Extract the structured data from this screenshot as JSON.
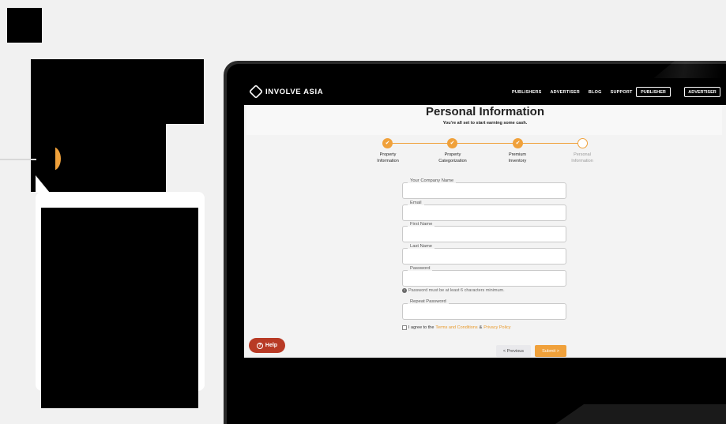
{
  "colors": {
    "accent": "#f0a13b",
    "help_red": "#b83a25",
    "navbar": "#000000"
  },
  "navbar": {
    "logo_text": "INVOLVE ASIA",
    "links": [
      "PUBLISHERS",
      "ADVERTISER",
      "BLOG",
      "SUPPORT"
    ],
    "publisher_button": "PUBLISHER",
    "advertiser_button": "ADVERTISER"
  },
  "page": {
    "title": "Personal Information",
    "subtitle": "You're all set to start earning some cash."
  },
  "stepper": {
    "steps": [
      {
        "label_line1": "Property",
        "label_line2": "Information",
        "state": "completed"
      },
      {
        "label_line1": "Property",
        "label_line2": "Categorization",
        "state": "completed"
      },
      {
        "label_line1": "Premium",
        "label_line2": "Inventory",
        "state": "completed"
      },
      {
        "label_line1": "Personal",
        "label_line2": "Information",
        "state": "current"
      }
    ]
  },
  "form": {
    "company_label": "Your Company Name",
    "email_label": "Email",
    "first_name_label": "First Name",
    "last_name_label": "Last Name",
    "password_label": "Password",
    "password_hint": "Password must be at least 6 characters minimum.",
    "repeat_password_label": "Repeat Password",
    "agree_prefix": "I agree to the",
    "terms_link": "Terms and Conditions",
    "amp": "&",
    "privacy_link": "Privacy Policy"
  },
  "actions": {
    "help": "Help",
    "previous": "< Previous",
    "submit": "Submit >"
  }
}
